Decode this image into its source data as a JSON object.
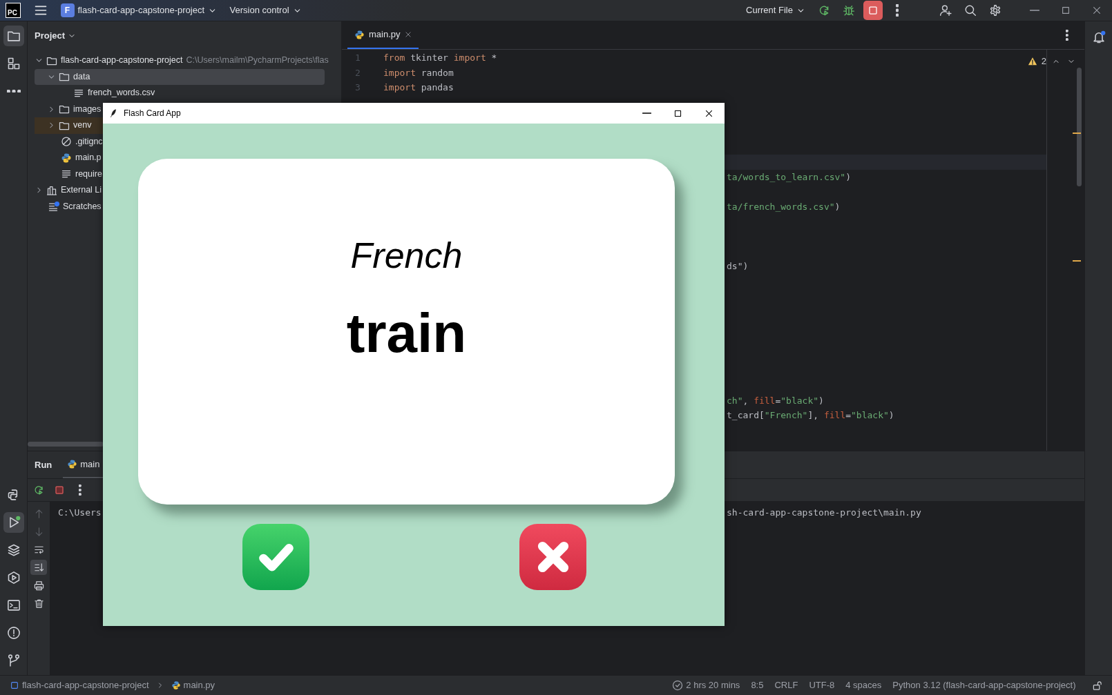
{
  "top_bar": {
    "logo": "PC",
    "project": {
      "badge": "F",
      "name": "flash-card-app-capstone-project"
    },
    "vcs": "Version control",
    "run_config": "Current File",
    "running": true
  },
  "tool_strip": {
    "top": [
      {
        "kind": "project",
        "selected": true
      },
      {
        "kind": "structure",
        "selected": false
      },
      {
        "kind": "more",
        "selected": false
      }
    ],
    "bottom": [
      {
        "kind": "python",
        "selected": false
      },
      {
        "kind": "run",
        "selected": true
      },
      {
        "kind": "layers",
        "selected": false
      },
      {
        "kind": "services",
        "selected": false
      },
      {
        "kind": "terminal",
        "selected": false
      },
      {
        "kind": "problems",
        "selected": false
      },
      {
        "kind": "git",
        "selected": false
      }
    ]
  },
  "project_panel": {
    "title": "Project",
    "tree": [
      {
        "name": "flash-card-app-capstone-project",
        "path": "C:\\Users\\mailm\\PycharmProjects\\flas",
        "kind": "folder",
        "expanded": true,
        "selected": false,
        "excluded": false,
        "children": [
          {
            "name": "data",
            "kind": "folder",
            "expanded": true,
            "selected": true,
            "excluded": false,
            "children": [
              {
                "name": "french_words.csv",
                "kind": "text",
                "selected": false,
                "excluded": false
              }
            ]
          },
          {
            "name": "images",
            "kind": "folder",
            "expanded": false,
            "selected": false,
            "excluded": false
          },
          {
            "name": "venv",
            "kind": "folder",
            "expanded": false,
            "selected": false,
            "excluded": true
          },
          {
            "name": ".gitignc",
            "kind": "ignore",
            "selected": false,
            "excluded": false
          },
          {
            "name": "main.p",
            "kind": "python",
            "selected": false,
            "excluded": false
          },
          {
            "name": "require",
            "kind": "text",
            "selected": false,
            "excluded": false
          }
        ]
      },
      {
        "name": "External Li",
        "kind": "library",
        "expanded": false,
        "selected": false,
        "excluded": false
      },
      {
        "name": "Scratches",
        "kind": "scratches",
        "selected": false,
        "excluded": false
      }
    ]
  },
  "editor": {
    "tabs": [
      {
        "label": "main.py",
        "selected": true
      }
    ],
    "warnings": "2",
    "lines": [
      {
        "kind": "code",
        "number": "1",
        "current": false,
        "tokens": [
          {
            "text": "from",
            "kind": "keyword"
          },
          {
            "text": " tkinter ",
            "kind": "plain"
          },
          {
            "text": "import",
            "kind": "keyword"
          },
          {
            "text": " *",
            "kind": "plain"
          }
        ]
      },
      {
        "kind": "code",
        "number": "2",
        "current": false,
        "tokens": [
          {
            "text": "import",
            "kind": "keyword"
          },
          {
            "text": " random",
            "kind": "plain"
          }
        ]
      },
      {
        "kind": "code",
        "number": "3",
        "current": false,
        "tokens": [
          {
            "text": "import",
            "kind": "keyword"
          },
          {
            "text": " pandas",
            "kind": "plain"
          }
        ]
      },
      {
        "kind": "blank",
        "current": false
      },
      {
        "kind": "blank",
        "current": false
      },
      {
        "kind": "blank",
        "current": false
      },
      {
        "kind": "blank",
        "current": false
      },
      {
        "kind": "blank",
        "current": true
      },
      {
        "kind": "tail",
        "current": false,
        "tokens": [
          {
            "text": "ta/words_to_learn.csv\"",
            "kind": "string"
          },
          {
            "text": ")",
            "kind": "plain"
          }
        ]
      },
      {
        "kind": "blank",
        "current": false
      },
      {
        "kind": "tail",
        "current": false,
        "tokens": [
          {
            "text": "ta/french_words.csv\"",
            "kind": "string"
          },
          {
            "text": ")",
            "kind": "plain"
          }
        ]
      },
      {
        "kind": "blank",
        "current": false
      },
      {
        "kind": "blank",
        "current": false
      },
      {
        "kind": "blank",
        "current": false
      },
      {
        "kind": "tail",
        "current": false,
        "tokens": [
          {
            "text": "ds\")",
            "kind": "plain"
          }
        ]
      },
      {
        "kind": "blank",
        "current": false
      },
      {
        "kind": "blank",
        "current": false
      },
      {
        "kind": "blank",
        "current": false
      },
      {
        "kind": "blank",
        "current": false
      },
      {
        "kind": "blank",
        "current": false
      },
      {
        "kind": "blank",
        "current": false
      },
      {
        "kind": "blank",
        "current": false
      },
      {
        "kind": "blank",
        "current": false
      },
      {
        "kind": "tail",
        "current": false,
        "tokens": [
          {
            "text": "ch\"",
            "kind": "string"
          },
          {
            "text": ", ",
            "kind": "plain"
          },
          {
            "text": "fill",
            "kind": "param"
          },
          {
            "text": "=",
            "kind": "plain"
          },
          {
            "text": "\"black\"",
            "kind": "string"
          },
          {
            "text": ")",
            "kind": "plain"
          }
        ]
      },
      {
        "kind": "tail",
        "current": false,
        "tokens": [
          {
            "text": "t_card[",
            "kind": "plain"
          },
          {
            "text": "\"French\"",
            "kind": "string"
          },
          {
            "text": "], ",
            "kind": "plain"
          },
          {
            "text": "fill",
            "kind": "param"
          },
          {
            "text": "=",
            "kind": "plain"
          },
          {
            "text": "\"black\"",
            "kind": "string"
          },
          {
            "text": ")",
            "kind": "plain"
          }
        ]
      }
    ]
  },
  "run_panel": {
    "title": "Run",
    "tabs": [
      {
        "label": "main",
        "selected": true
      }
    ],
    "tools": [
      {
        "kind": "rerun"
      },
      {
        "kind": "stop"
      },
      {
        "kind": "more"
      }
    ],
    "side_tools": [
      {
        "kind": "up",
        "disabled": true,
        "selected": false
      },
      {
        "kind": "down",
        "disabled": true,
        "selected": false
      },
      {
        "kind": "wrap",
        "disabled": false,
        "selected": false
      },
      {
        "kind": "scroll-end",
        "disabled": false,
        "selected": true
      },
      {
        "kind": "print",
        "disabled": false,
        "selected": false
      },
      {
        "kind": "trash",
        "disabled": false,
        "selected": false
      }
    ],
    "console": [
      {
        "start": "C:\\Users",
        "tail": "sh-card-app-capstone-project\\main.py"
      }
    ]
  },
  "notifications": {
    "unread": true
  },
  "status_bar": {
    "breadcrumbs": [
      {
        "label": "flash-card-app-capstone-project",
        "kind": "module"
      },
      {
        "label": "main.py",
        "kind": "python"
      }
    ],
    "items": [
      {
        "label": "2 hrs 20 mins",
        "kind": "timer"
      },
      {
        "label": "8:5",
        "kind": "text"
      },
      {
        "label": "CRLF",
        "kind": "text"
      },
      {
        "label": "UTF-8",
        "kind": "text"
      },
      {
        "label": "4 spaces",
        "kind": "text"
      },
      {
        "label": "Python 3.12 (flash-card-app-capstone-project)",
        "kind": "text"
      }
    ]
  },
  "app_window": {
    "title": "Flash Card App",
    "card": {
      "language": "French",
      "word": "train"
    },
    "answer_buttons": [
      {
        "kind": "known"
      },
      {
        "kind": "unknown"
      }
    ]
  }
}
